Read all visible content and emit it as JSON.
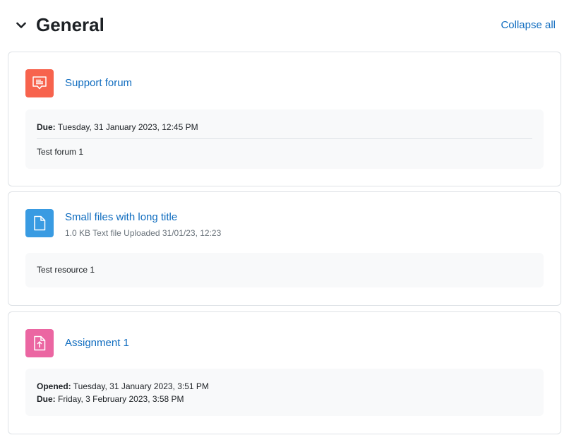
{
  "section": {
    "title": "General",
    "collapse_all": "Collapse all"
  },
  "activities": [
    {
      "name": "Support forum",
      "icon": "forum-icon",
      "color": "#f7634d",
      "dates": [
        {
          "label": "Due:",
          "value": "Tuesday, 31 January 2023, 12:45 PM"
        }
      ],
      "description": "Test forum 1"
    },
    {
      "name": "Small files with long title",
      "icon": "file-icon",
      "color": "#399be2",
      "meta": "1.0 KB Text file Uploaded 31/01/23, 12:23",
      "description": "Test resource 1"
    },
    {
      "name": "Assignment 1",
      "icon": "assignment-icon",
      "color": "#eb66a2",
      "dates": [
        {
          "label": "Opened:",
          "value": "Tuesday, 31 January 2023, 3:51 PM"
        },
        {
          "label": "Due:",
          "value": "Friday, 3 February 2023, 3:58 PM"
        }
      ]
    }
  ],
  "colors": {
    "link": "#0f6cbf",
    "border": "#dee2e6",
    "info_bg": "#f8f9fa"
  }
}
